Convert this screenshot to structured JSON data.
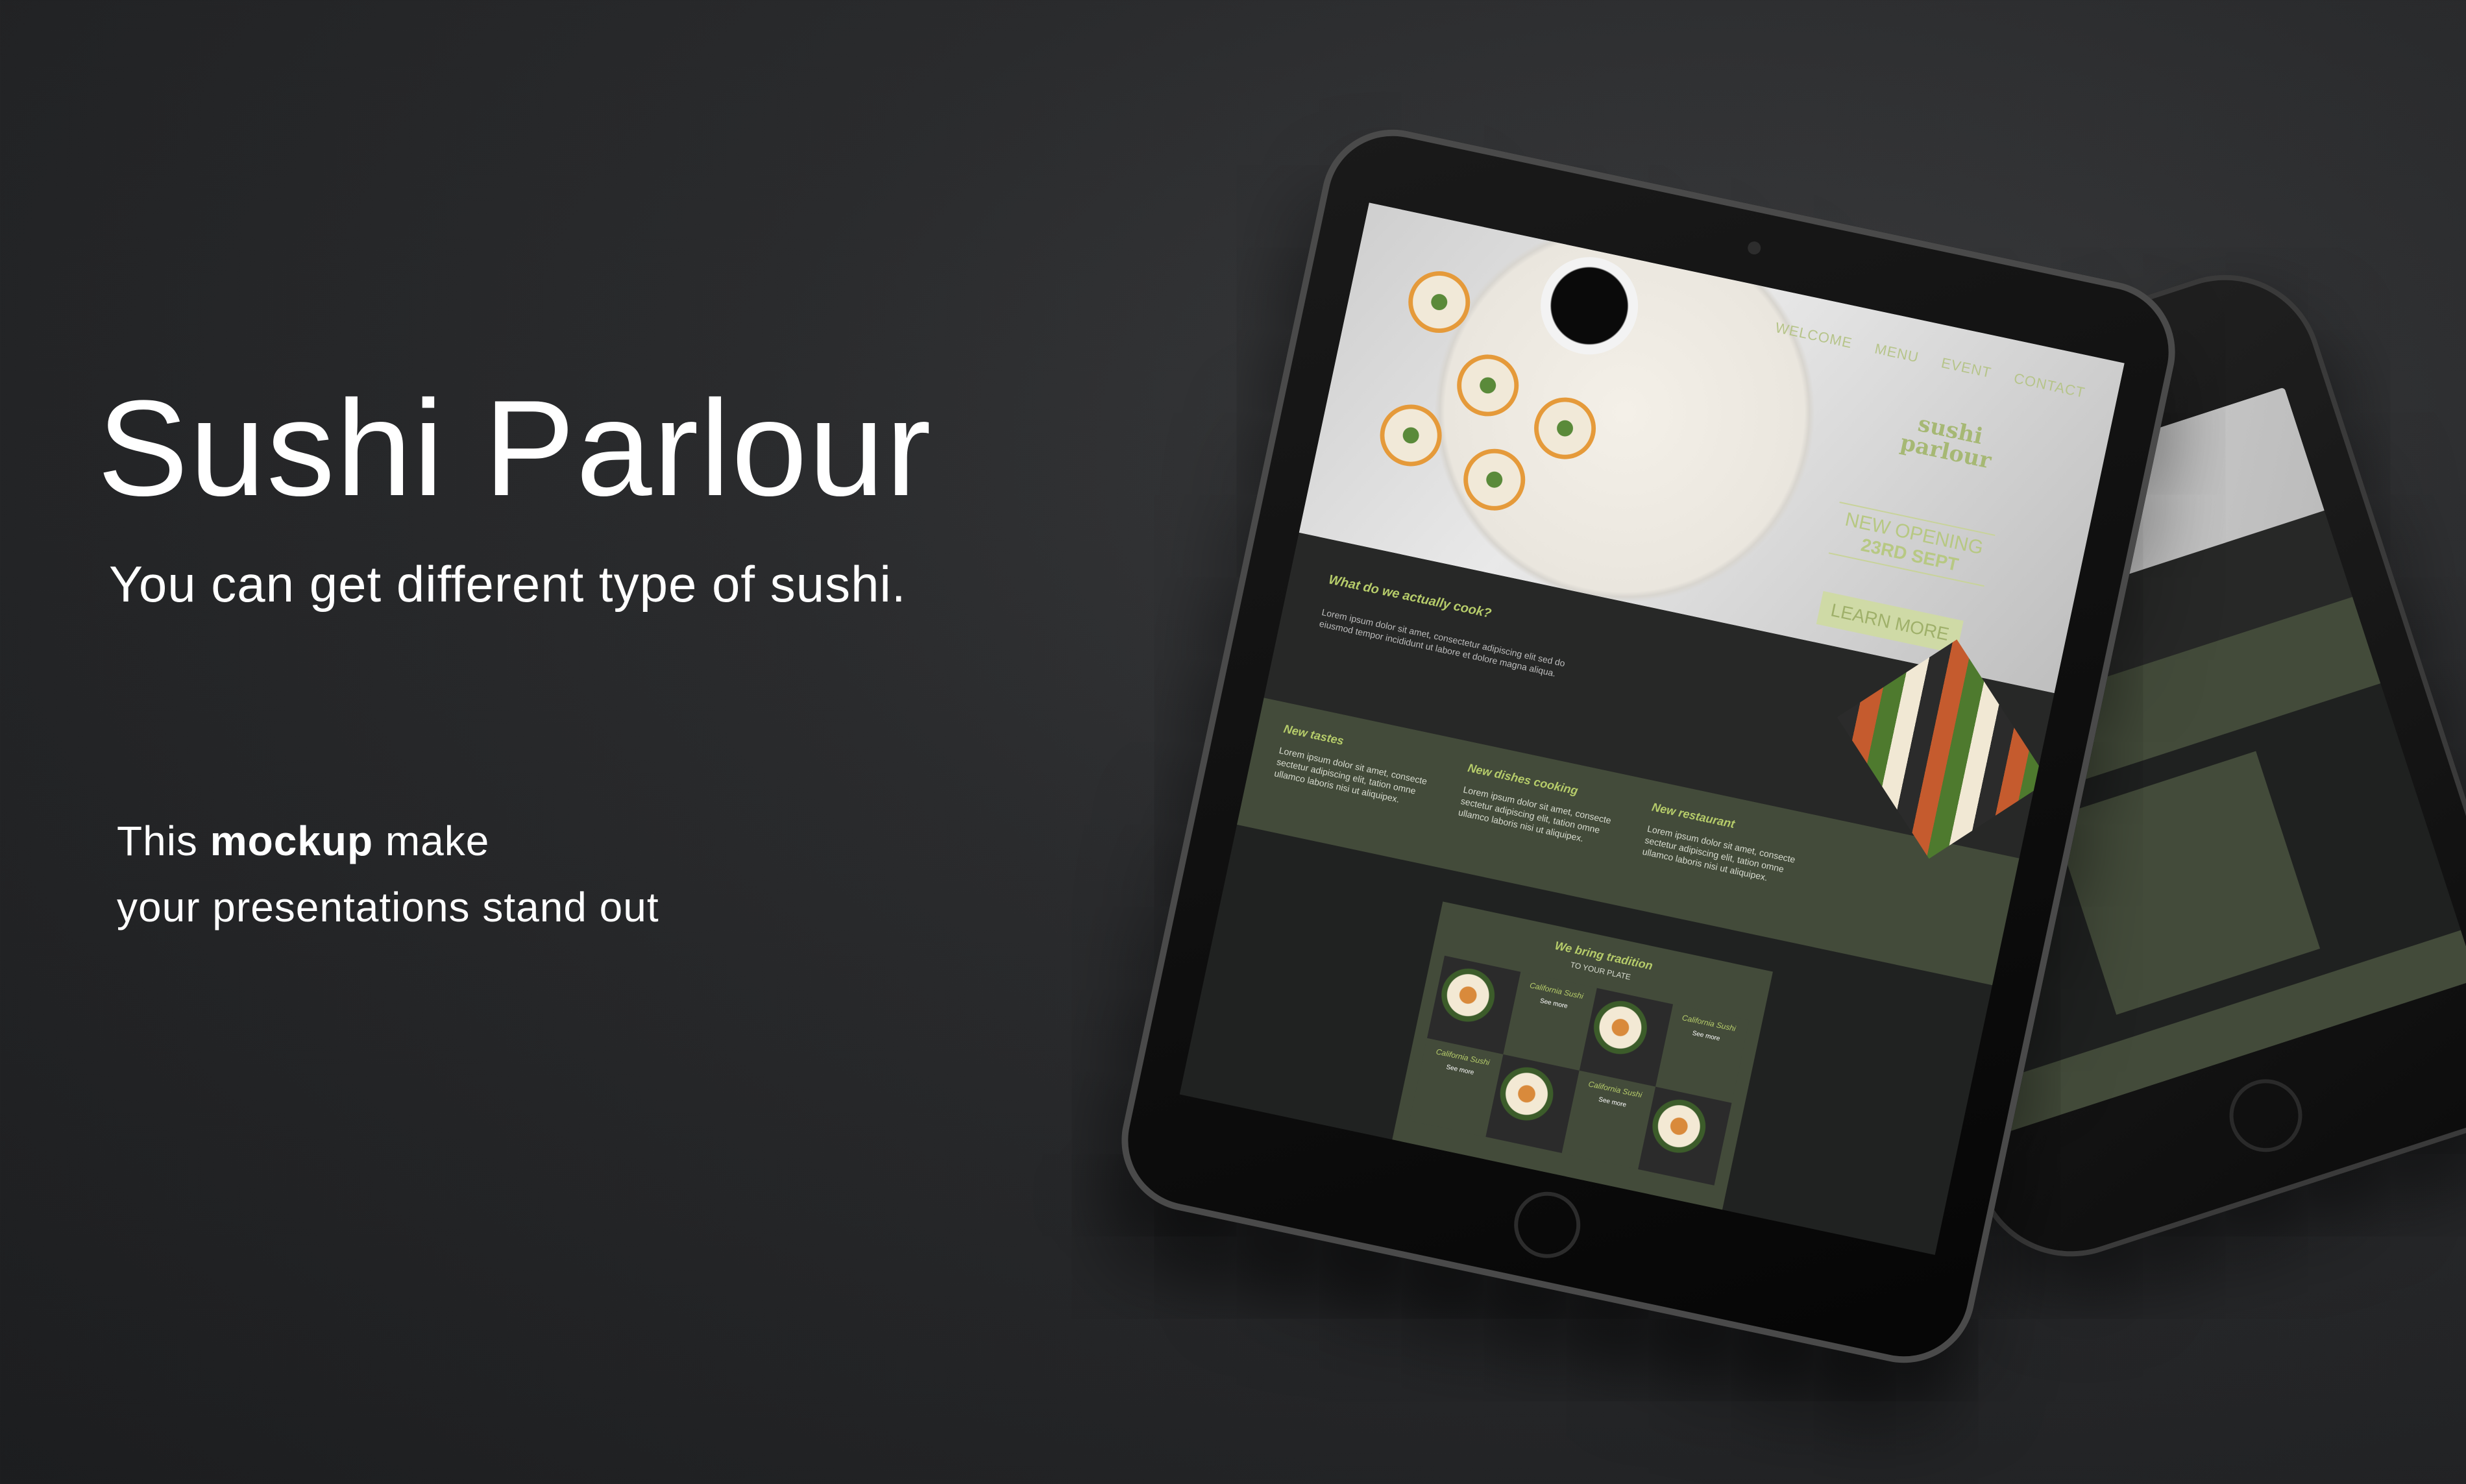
{
  "hero": {
    "title": "Sushi Parlour",
    "subtitle": "You can get different type of sushi.",
    "pitch_pre": "This ",
    "pitch_bold": "mockup",
    "pitch_post": " make",
    "pitch_line2": "your presentations  stand out"
  },
  "site": {
    "nav": [
      "WELCOME",
      "MENU",
      "EVENT",
      "CONTACT"
    ],
    "logo_line1": "sushi",
    "logo_line2": "parlour",
    "opening_label": "NEW OPENING",
    "opening_date": "23RD SEPT",
    "cta_label": "LEARN MORE",
    "about_heading": "What do we actually cook?",
    "about_text": "Lorem ipsum dolor sit amet, consectetur adipiscing elit sed do eiusmod tempor incididunt ut labore et dolore magna aliqua.",
    "features": [
      {
        "title": "New tastes",
        "text": "Lorem ipsum dolor sit amet, consecte sectetur adipiscing elit, tation omne ullamco laboris nisi ut aliquipex."
      },
      {
        "title": "New dishes cooking",
        "text": "Lorem ipsum dolor sit amet, consecte sectetur adipiscing elit, tation omne ullamco laboris nisi ut aliquipex."
      },
      {
        "title": "New restaurant",
        "text": "Lorem ipsum dolor sit amet, consecte sectetur adipiscing elit, tation omne ullamco laboris nisi ut aliquipex."
      }
    ],
    "tradition_heading": "We bring tradition",
    "tradition_sub": "TO YOUR PLATE",
    "menu_items": [
      {
        "name": "California Sushi",
        "more": "See more"
      },
      {
        "name": "California Sushi",
        "more": "See more"
      },
      {
        "name": "California Sushi",
        "more": "See more"
      },
      {
        "name": "California Sushi",
        "more": "See more"
      }
    ]
  },
  "colors": {
    "background": "#2a2b2d",
    "accent": "#b6cc6a",
    "panel_green": "#434b3a"
  }
}
